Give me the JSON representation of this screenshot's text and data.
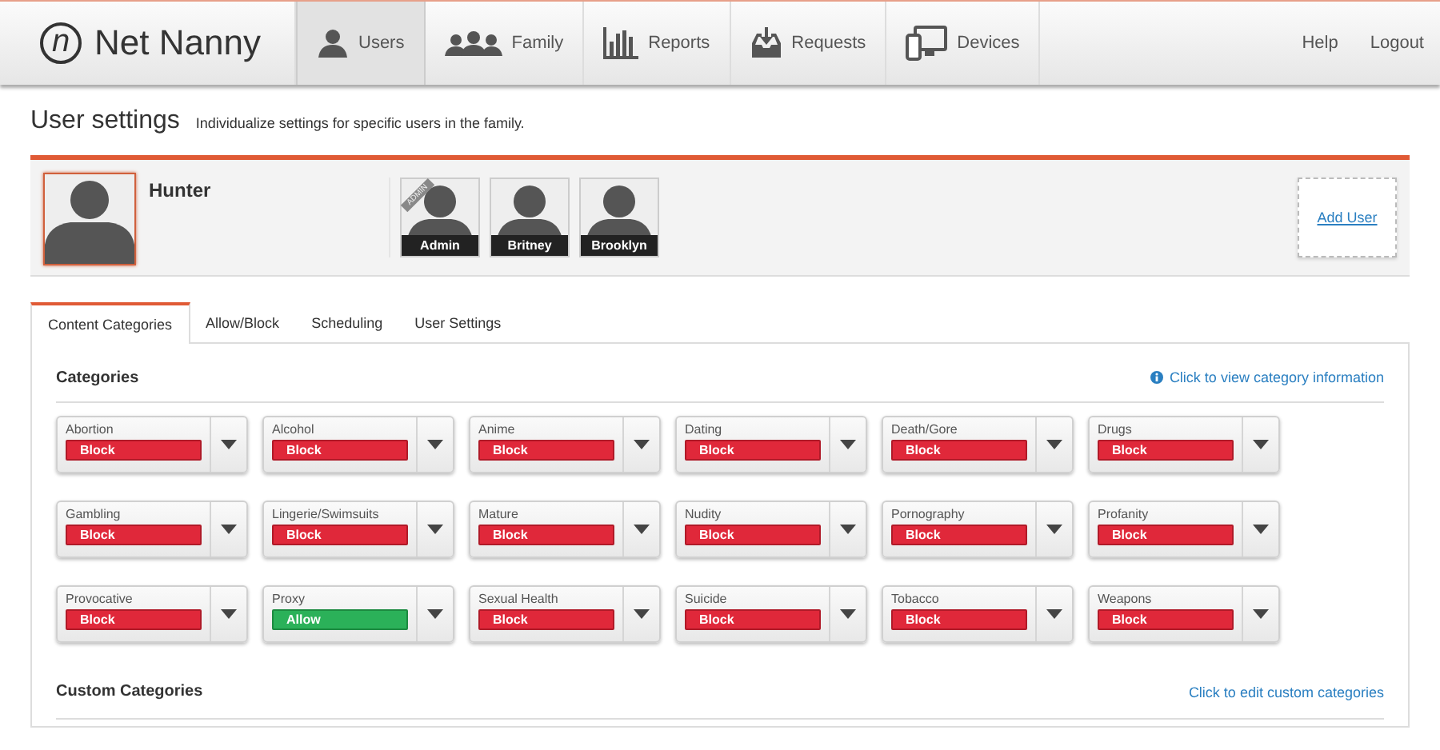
{
  "header": {
    "logo_mark": "n",
    "logo_text": "Net Nanny",
    "nav": [
      {
        "label": "Users",
        "kind": "person",
        "selected": true
      },
      {
        "label": "Family",
        "kind": "people",
        "selected": false
      },
      {
        "label": "Reports",
        "kind": "chart",
        "selected": false
      },
      {
        "label": "Requests",
        "kind": "inbox",
        "selected": false
      },
      {
        "label": "Devices",
        "kind": "devices",
        "selected": false
      }
    ],
    "links": [
      "Help",
      "Logout"
    ]
  },
  "page": {
    "title": "User settings",
    "subtitle": "Individualize settings for specific users in the family."
  },
  "current_user": {
    "name": "Hunter"
  },
  "users": [
    {
      "name": "Admin",
      "ribbon": "ADMIN"
    },
    {
      "name": "Britney"
    },
    {
      "name": "Brooklyn"
    }
  ],
  "add_user": "Add User",
  "tabs": [
    {
      "label": "Content Categories",
      "selected": true
    },
    {
      "label": "Allow/Block",
      "selected": false
    },
    {
      "label": "Scheduling",
      "selected": false
    },
    {
      "label": "User Settings",
      "selected": false
    }
  ],
  "categories_section": {
    "title": "Categories",
    "link": "Click to view category information",
    "items": [
      {
        "name": "Abortion",
        "status": "Block",
        "allowed": false
      },
      {
        "name": "Alcohol",
        "status": "Block",
        "allowed": false
      },
      {
        "name": "Anime",
        "status": "Block",
        "allowed": false
      },
      {
        "name": "Dating",
        "status": "Block",
        "allowed": false
      },
      {
        "name": "Death/Gore",
        "status": "Block",
        "allowed": false
      },
      {
        "name": "Drugs",
        "status": "Block",
        "allowed": false
      },
      {
        "name": "Gambling",
        "status": "Block",
        "allowed": false
      },
      {
        "name": "Lingerie/Swimsuits",
        "status": "Block",
        "allowed": false
      },
      {
        "name": "Mature",
        "status": "Block",
        "allowed": false
      },
      {
        "name": "Nudity",
        "status": "Block",
        "allowed": false
      },
      {
        "name": "Pornography",
        "status": "Block",
        "allowed": false
      },
      {
        "name": "Profanity",
        "status": "Block",
        "allowed": false
      },
      {
        "name": "Provocative",
        "status": "Block",
        "allowed": false
      },
      {
        "name": "Proxy",
        "status": "Allow",
        "allowed": true
      },
      {
        "name": "Sexual Health",
        "status": "Block",
        "allowed": false
      },
      {
        "name": "Suicide",
        "status": "Block",
        "allowed": false
      },
      {
        "name": "Tobacco",
        "status": "Block",
        "allowed": false
      },
      {
        "name": "Weapons",
        "status": "Block",
        "allowed": false
      }
    ]
  },
  "custom_section": {
    "title": "Custom Categories",
    "link": "Click to edit custom categories"
  }
}
